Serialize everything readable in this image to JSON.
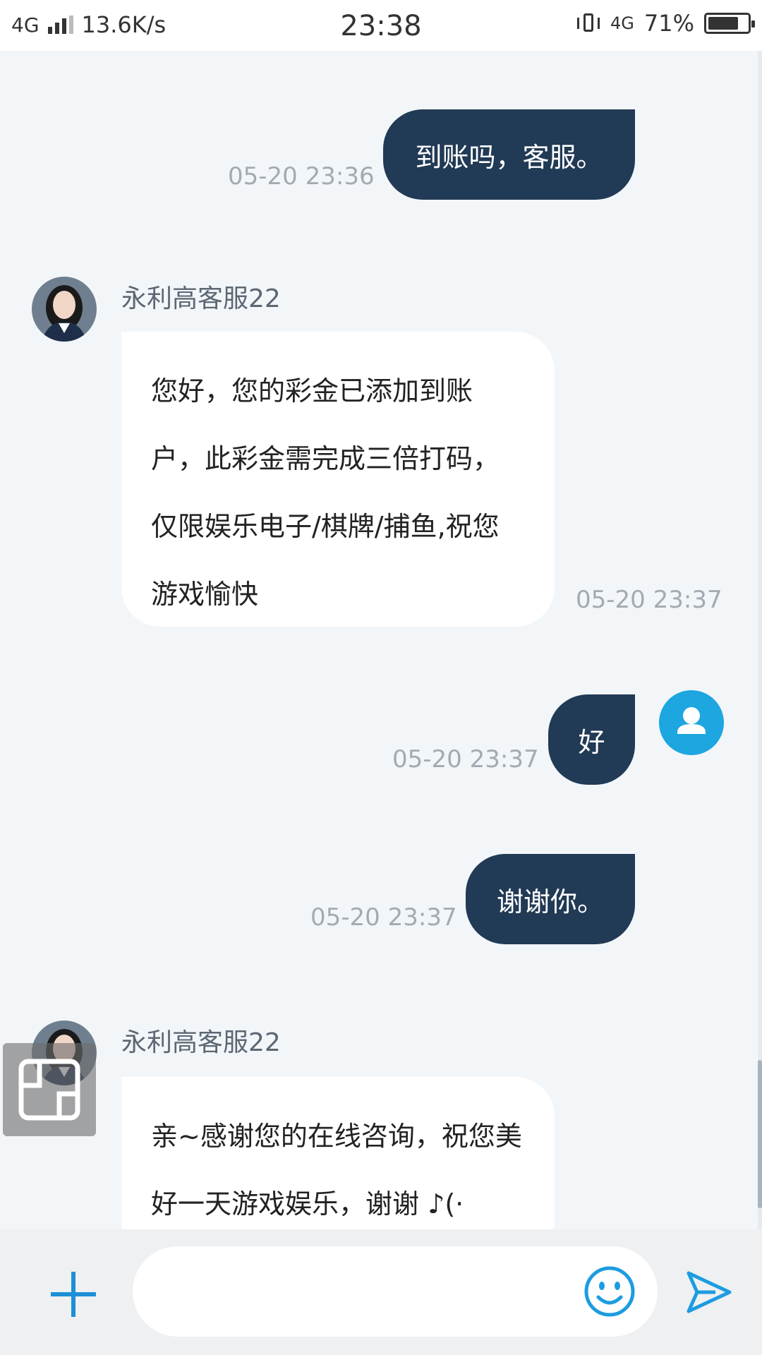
{
  "status_bar": {
    "network": "4G",
    "speed": "13.6K/s",
    "time": "23:38",
    "network2": "4G",
    "battery": "71%"
  },
  "messages": [
    {
      "type": "out",
      "text": "到账吗，客服。",
      "time": "05-20 23:36"
    },
    {
      "type": "in",
      "sender": "永利高客服22",
      "lines": [
        "您好，您的彩金已添加到账",
        "户，此彩金需完成三倍打码，",
        "仅限娱乐电子/棋牌/捕鱼,祝您",
        "游戏愉快"
      ],
      "time": "05-20 23:37"
    },
    {
      "type": "out",
      "text": "好",
      "time": "05-20 23:37"
    },
    {
      "type": "out",
      "text": "谢谢你。",
      "time": "05-20 23:37"
    },
    {
      "type": "in",
      "sender": "永利高客服22",
      "lines": [
        "亲~感谢您的在线咨询，祝您美",
        "好一天游戏娱乐，谢谢 ♪(·"
      ]
    }
  ],
  "input": {
    "value": ""
  },
  "colors": {
    "outgoing_bubble": "#213a55",
    "accent": "#1da6df",
    "background": "#f3f6f9"
  },
  "icons": [
    "plus-icon",
    "emoji-icon",
    "send-icon",
    "user-icon",
    "scan-icon"
  ]
}
